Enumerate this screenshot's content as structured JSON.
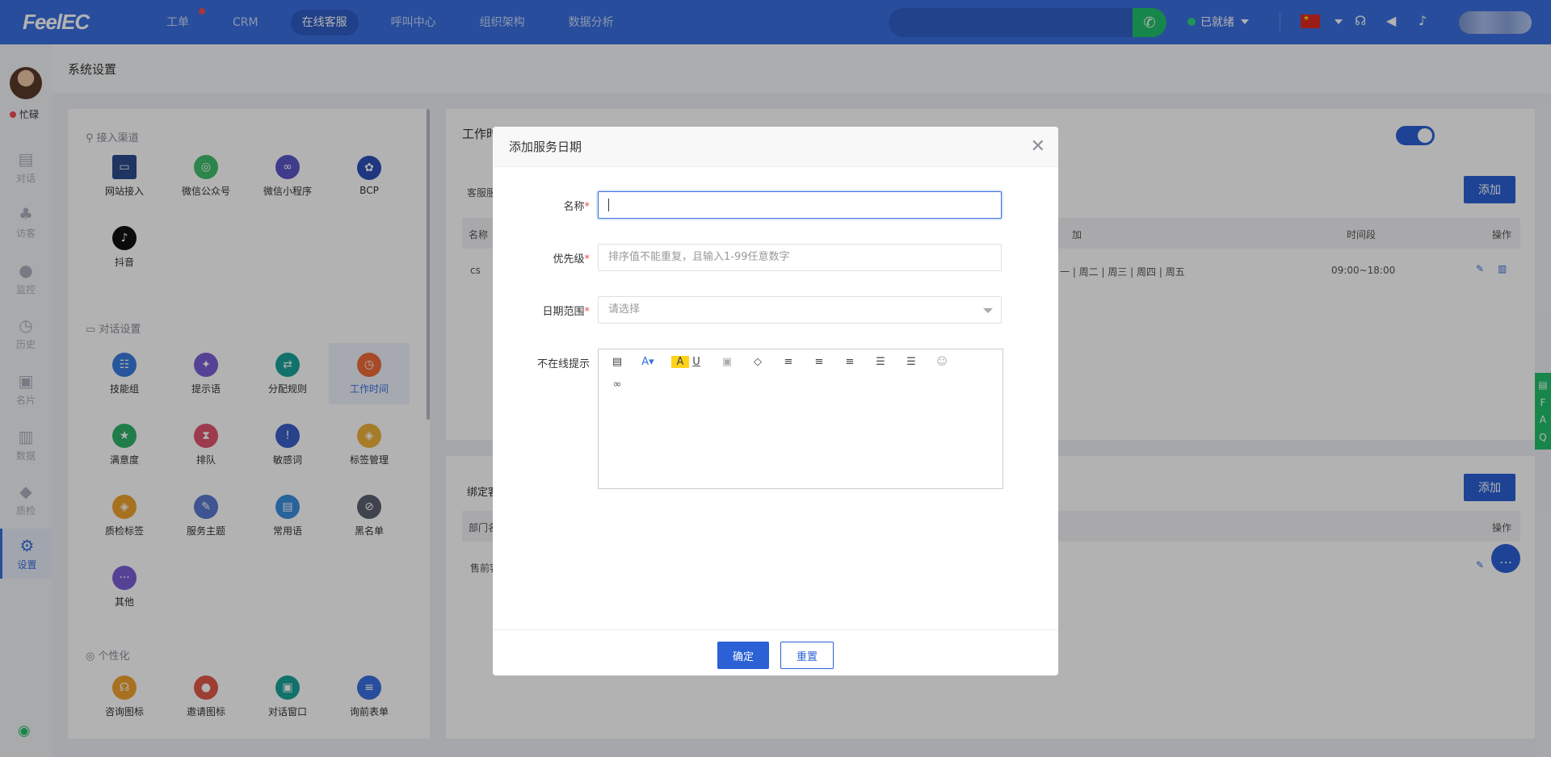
{
  "topbar": {
    "logo": "FeelEC",
    "nav": [
      "工单",
      "CRM",
      "在线客服",
      "呼叫中心",
      "组织架构",
      "数据分析"
    ],
    "active_nav": "在线客服",
    "status": "已就绪"
  },
  "sidebar": {
    "status": "忙碌",
    "items": [
      "对话",
      "访客",
      "监控",
      "历史",
      "名片",
      "数据",
      "质检",
      "设置"
    ],
    "active": "设置"
  },
  "page": {
    "title": "系统设置"
  },
  "left_panel": {
    "sections": [
      {
        "title": "接入渠道",
        "items": [
          "网站接入",
          "微信公众号",
          "微信小程序",
          "BCP",
          "抖音"
        ]
      },
      {
        "title": "对话设置",
        "items": [
          "技能组",
          "提示语",
          "分配规则",
          "工作时间",
          "满意度",
          "排队",
          "敏感词",
          "标签管理",
          "质检标签",
          "服务主题",
          "常用语",
          "黑名单",
          "其他"
        ]
      },
      {
        "title": "个性化",
        "items": [
          "咨询图标",
          "邀请图标",
          "对话窗口",
          "询前表单"
        ]
      }
    ],
    "active_item": "工作时间"
  },
  "right_panel": {
    "section1": {
      "title": "工作时",
      "sub": "客服服",
      "add": "添加",
      "headers": [
        "名称",
        "加",
        "时间段",
        "操作"
      ],
      "row": {
        "name": "cs",
        "days": "一 | 周二 | 周三 | 周四 | 周五",
        "time": "09:00~18:00"
      }
    },
    "section2": {
      "title": "绑定客",
      "add": "添加",
      "headers": [
        "部门名",
        "操作"
      ],
      "row": {
        "name": "售前客"
      }
    }
  },
  "modal": {
    "title": "添加服务日期",
    "fields": {
      "name": {
        "label": "名称",
        "value": ""
      },
      "priority": {
        "label": "优先级",
        "placeholder": "排序值不能重复，且输入1-99任意数字"
      },
      "date_range": {
        "label": "日期范围",
        "placeholder": "请选择"
      },
      "offline_tip": {
        "label": "不在线提示"
      }
    },
    "confirm": "确定",
    "reset": "重置"
  },
  "faq": [
    "F",
    "A",
    "Q"
  ]
}
